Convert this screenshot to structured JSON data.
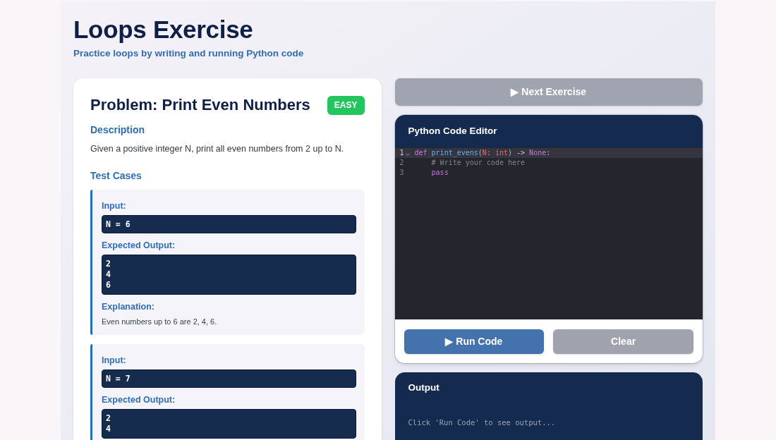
{
  "header": {
    "title": "Loops Exercise",
    "subtitle": "Practice loops by writing and running Python code"
  },
  "problem": {
    "title": "Problem: Print Even Numbers",
    "difficulty_badge": "EASY",
    "description_heading": "Description",
    "description": "Given a positive integer N, print all even numbers from 2 up to N.",
    "test_cases_heading": "Test Cases",
    "test_cases": [
      {
        "input_label": "Input:",
        "input": "N = 6",
        "output_label": "Expected Output:",
        "output": [
          "2",
          "4",
          "6"
        ],
        "explanation_label": "Explanation:",
        "explanation": "Even numbers up to 6 are 2, 4, 6."
      },
      {
        "input_label": "Input:",
        "input": "N = 7",
        "output_label": "Expected Output:",
        "output": [
          "2",
          "4"
        ]
      }
    ]
  },
  "next_button": {
    "label": "▶ Next Exercise",
    "disabled": true
  },
  "editor": {
    "title": "Python Code Editor",
    "lines": [
      {
        "number": "1",
        "active": true,
        "foldable": true,
        "tokens": [
          {
            "text": "def",
            "kind": "keyword"
          },
          {
            "text": " print_evens",
            "kind": "function"
          },
          {
            "text": "(",
            "kind": "punct"
          },
          {
            "text": "N",
            "kind": "param"
          },
          {
            "text": ":",
            "kind": "punct"
          },
          {
            "text": " int",
            "kind": "type"
          },
          {
            "text": ")",
            "kind": "punct"
          },
          {
            "text": " ->",
            "kind": "operator"
          },
          {
            "text": " None",
            "kind": "keyword"
          },
          {
            "text": ":",
            "kind": "punct"
          }
        ]
      },
      {
        "number": "2",
        "active": false,
        "foldable": false,
        "tokens": [
          {
            "text": "    # Write your code here",
            "kind": "comment"
          }
        ]
      },
      {
        "number": "3",
        "active": false,
        "foldable": false,
        "tokens": [
          {
            "text": "    pass",
            "kind": "keyword"
          }
        ]
      }
    ],
    "buttons": [
      {
        "label": "▶ Run Code",
        "kind": "primary"
      },
      {
        "label": "Clear",
        "kind": "secondary"
      }
    ]
  },
  "output": {
    "title": "Output",
    "message": "Click 'Run Code' to see output..."
  }
}
